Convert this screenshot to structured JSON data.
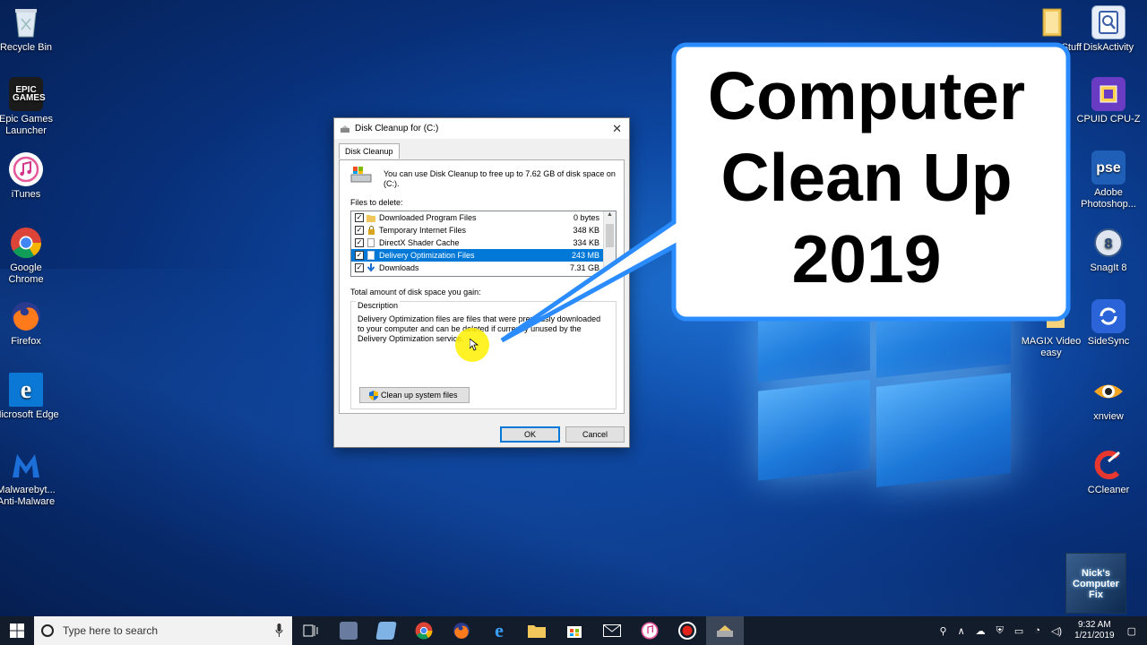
{
  "desktop_left": [
    {
      "label": "Recycle Bin",
      "icon": "recycle-bin-icon"
    },
    {
      "label": "Epic Games Launcher",
      "icon": "epic-games-icon",
      "badge": "EPIC GAMES"
    },
    {
      "label": "iTunes",
      "icon": "itunes-icon"
    },
    {
      "label": "Google Chrome",
      "icon": "chrome-icon"
    },
    {
      "label": "Firefox",
      "icon": "firefox-icon"
    },
    {
      "label": "Microsoft Edge",
      "icon": "edge-icon"
    },
    {
      "label": "Malwarebyt... Anti-Malware",
      "icon": "malwarebytes-icon"
    }
  ],
  "desktop_right": [
    {
      "label": "DiskActivity",
      "icon": "diskactivity-icon"
    },
    {
      "label": "CPUID CPU-Z",
      "icon": "cpuz-icon"
    },
    {
      "label": "Adobe Photoshop...",
      "icon": "photoshop-icon",
      "badge": "pse"
    },
    {
      "label": "SnagIt 8",
      "icon": "snagit-icon"
    },
    {
      "label": "SideSync",
      "icon": "sidesync-icon"
    },
    {
      "label": "xnview",
      "icon": "xnview-icon"
    },
    {
      "label": "CCleaner",
      "icon": "ccleaner-icon"
    }
  ],
  "desktop_partial": [
    {
      "label": "Stuff",
      "icon": "folder-icon"
    },
    {
      "label": "MAGIX Video easy",
      "icon": "magix-icon"
    }
  ],
  "dialog": {
    "title": "Disk Cleanup for  (C:)",
    "tab": "Disk Cleanup",
    "intro": "You can use Disk Cleanup to free up to 7.62 GB of disk space on  (C:).",
    "files_label": "Files to delete:",
    "files": [
      {
        "name": "Downloaded Program Files",
        "size": "0 bytes",
        "checked": "✓"
      },
      {
        "name": "Temporary Internet Files",
        "size": "348 KB",
        "checked": "✓"
      },
      {
        "name": "DirectX Shader Cache",
        "size": "334 KB",
        "checked": "✓"
      },
      {
        "name": "Delivery Optimization Files",
        "size": "243 MB",
        "checked": "✓"
      },
      {
        "name": "Downloads",
        "size": "7.31 GB",
        "checked": "✓"
      }
    ],
    "total_label": "Total amount of disk space you gain:",
    "description_label": "Description",
    "description": "Delivery Optimization files are files that were previously downloaded to your computer and can be deleted if currently unused by the Delivery Optimization service.",
    "system_button": "Clean up system files",
    "ok": "OK",
    "cancel": "Cancel"
  },
  "callout": {
    "line1": "Computer",
    "line2": "Clean Up",
    "line3": "2019"
  },
  "watermark": {
    "line1": "Nick's",
    "line2": "Computer",
    "line3": "Fix"
  },
  "taskbar": {
    "search_placeholder": "Type here to search",
    "time": "9:32 AM",
    "date": "1/21/2019"
  },
  "colors": {
    "accent": "#0078d7",
    "callout_border": "#2a8cff",
    "highlight": "#fff000"
  }
}
